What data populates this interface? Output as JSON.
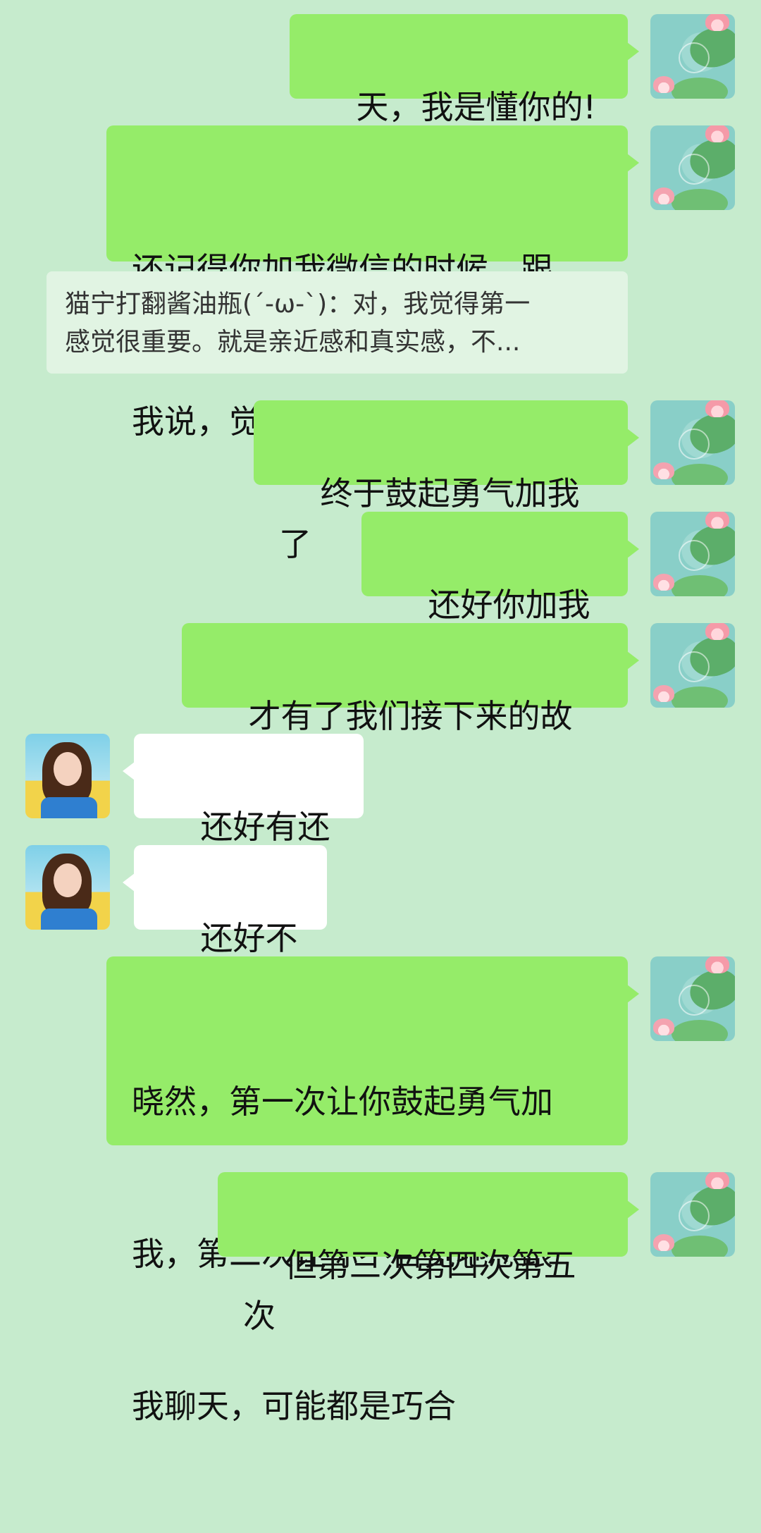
{
  "messages": [
    {
      "side": "self",
      "text": "天，我是懂你的!"
    },
    {
      "side": "self",
      "lines": [
        "还记得你加我微信的时候，跟",
        "我说，觉得我很高冷"
      ]
    },
    {
      "side": "self",
      "text": "终于鼓起勇气加我了"
    },
    {
      "side": "self",
      "text": "还好你加我了"
    },
    {
      "side": "self",
      "text": "才有了我们接下来的故事"
    },
    {
      "side": "other",
      "text": "还好有还好"
    },
    {
      "side": "other",
      "text": "还好不晚"
    },
    {
      "side": "self",
      "lines": [
        "晓然，第一次让你鼓起勇气加",
        "我，第二次让你不自觉地想跟",
        "我聊天，可能都是巧合"
      ]
    },
    {
      "side": "self",
      "text": "但第三次第四次第五次"
    }
  ],
  "quote": {
    "line1": "猫宁打翻酱油瓶(ˊ-ω-ˋ)：对，我觉得第一",
    "line2": "感觉很重要。就是亲近感和真实感，不..."
  },
  "colors": {
    "background": "#c6ebcd",
    "self_bubble": "#95ec69",
    "other_bubble": "#ffffff",
    "quote_bg": "#e1f4e3"
  }
}
